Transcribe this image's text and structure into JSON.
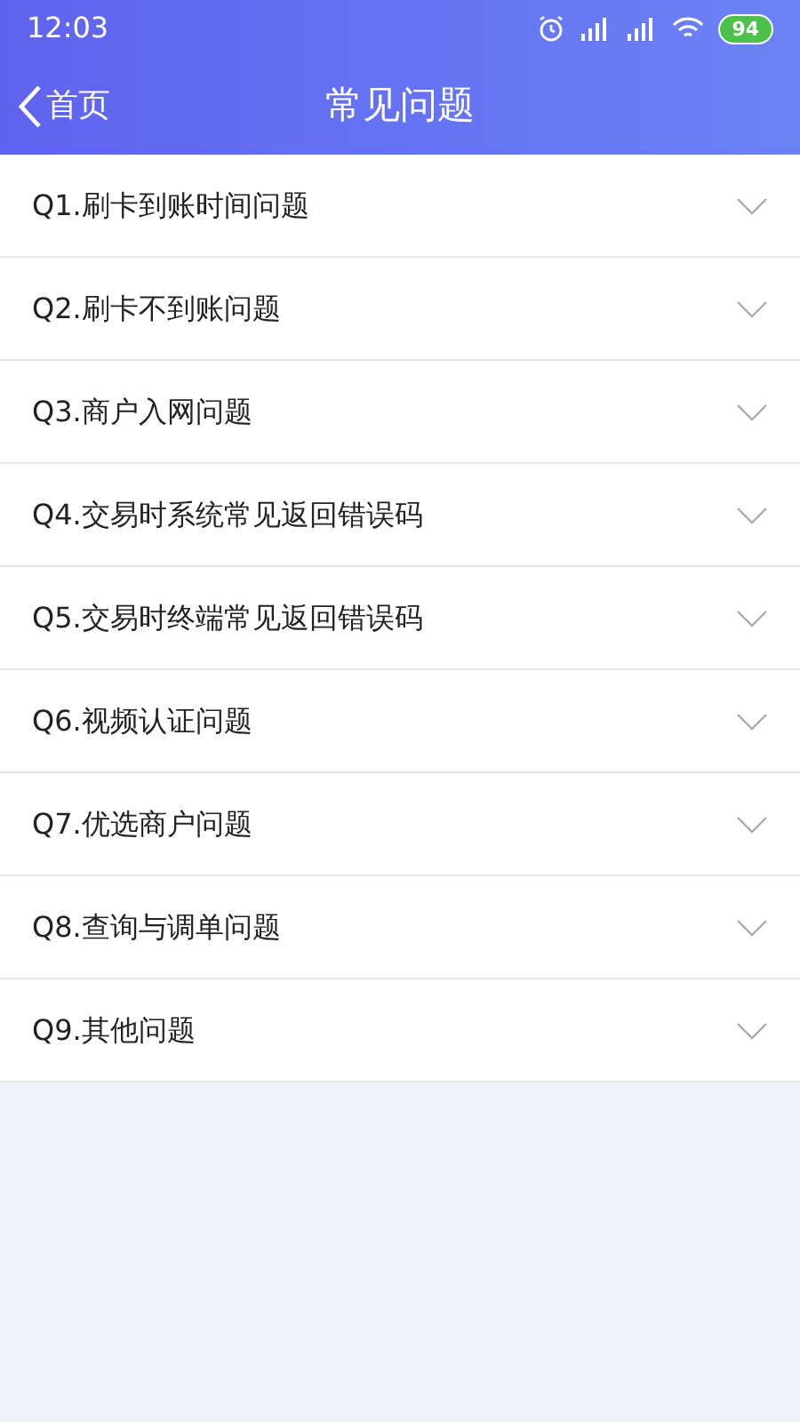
{
  "status_bar": {
    "time": "12:03",
    "battery": "94"
  },
  "nav_bar": {
    "back_label": "首页",
    "title": "常见问题"
  },
  "faq": [
    {
      "label": "Q1.刷卡到账时间问题",
      "expanded": false
    },
    {
      "label": "Q2.刷卡不到账问题",
      "expanded": false
    },
    {
      "label": "Q3.商户入网问题",
      "expanded": false
    },
    {
      "label": "Q4.交易时系统常见返回错误码",
      "expanded": false
    },
    {
      "label": "Q5.交易时终端常见返回错误码",
      "expanded": false
    },
    {
      "label": "Q6.视频认证问题",
      "expanded": false
    },
    {
      "label": "Q7.优选商户问题",
      "expanded": false
    },
    {
      "label": "Q8.查询与调单问题",
      "expanded": false
    },
    {
      "label": "Q9.其他问题",
      "expanded": false
    }
  ]
}
